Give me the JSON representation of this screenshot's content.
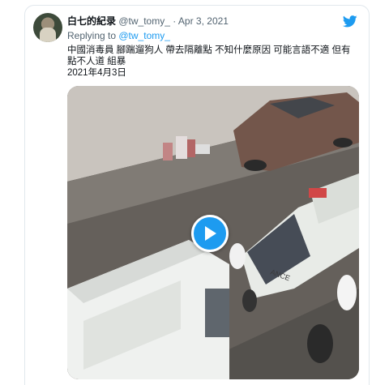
{
  "tweet": {
    "display_name": "白七的紀录",
    "handle": "@tw_tomy_",
    "separator": "·",
    "date": "Apr 3, 2021",
    "reply_prefix": "Replying to ",
    "reply_handle": "@tw_tomy_",
    "text_lines": [
      "中國消毒員 腳踹遛狗人 帶去隔離點 不知什麼原因 可能言語不適 但有",
      "點不人道 組暴",
      "2021年4月3日"
    ]
  },
  "icons": {
    "brand": "twitter-bird-icon",
    "play": "play-icon"
  },
  "colors": {
    "accent": "#1d9bf0",
    "text": "#0f1419",
    "muted": "#536471",
    "border": "#e1e8ed"
  }
}
